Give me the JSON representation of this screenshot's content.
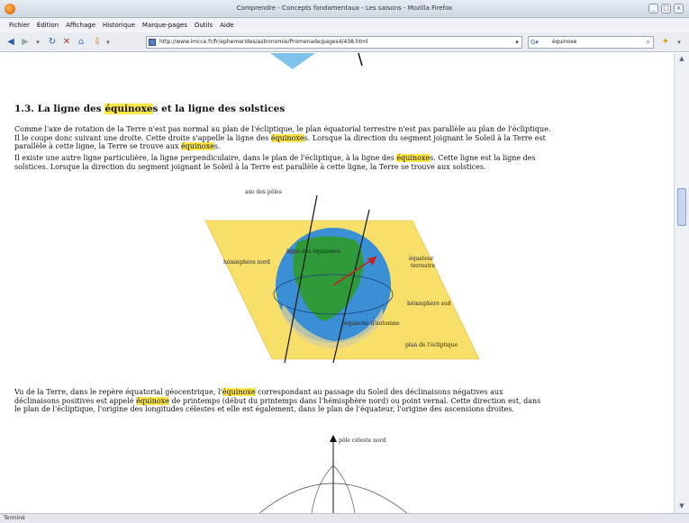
{
  "window": {
    "title": "Comprendre - Concepts fondamentaux - Les saisons - Mozilla Firefox",
    "buttons": [
      "_",
      "□",
      "×"
    ]
  },
  "menu": [
    "Fichier",
    "Édition",
    "Affichage",
    "Historique",
    "Marque-pages",
    "Outils",
    "Aide"
  ],
  "nav": {
    "url": "http://www.imcce.fr/fr/ephemerides/astronomie/Promenade/pages4/438.html",
    "search_value": "équinoxe",
    "search_engine": "G▾"
  },
  "content": {
    "heading_pre": "1.3. La ligne des ",
    "heading_hl": "équinoxe",
    "heading_post": "s et la ligne des solstices",
    "p1": {
      "a": "Comme l'axe de rotation de la Terre n'est pas normal au plan de l'écliptique, le plan équatorial terrestre n'est pas parallèle au plan de l'écliptique.",
      "b": "Il le coupe donc suivant une droite. Cette droite s'appelle la ligne des ",
      "b_hl": "équinoxe",
      "c": "s. Lorsque la direction du segment joignant le Soleil à la Terre est",
      "d": "parallèle à cette ligne, la Terre se trouve aux ",
      "d_hl": "équinoxe",
      "e": "s."
    },
    "p2": {
      "a": "Il existe une autre ligne particulière, la ligne perpendiculaire, dans le plan de l'écliptique, à la ligne des ",
      "a_hl": "équinoxe",
      "b": "s. Cette ligne est la ligne des",
      "c": "solstices. Lorsque la direction du segment joignant le Soleil à la Terre est parallèle à cette ligne, la Terre se trouve aux solstices."
    },
    "fig1_labels": {
      "axe": "axe des pôles",
      "hemi_nord": "hémisphère nord",
      "ligne": "ligne des équinoxes",
      "equateur_a": "équateur",
      "equateur_b": "terrestre",
      "hemi_sud": "hémisphère sud",
      "equinoxe": "équinoxe d'automne",
      "plan": "plan de l'écliptique"
    },
    "p3": {
      "a": "Vu de la Terre, dans le repère équatorial géocentrique, l'",
      "a_hl": "équinoxe",
      "b": " correspondant au passage du Soleil des déclinaisons négatives aux",
      "c": "déclinaisons positives est appelé ",
      "c_hl": "équinoxe",
      "d": " de printemps (début du printemps dans l'hémisphère nord) ou point vernal. Cette direction est, dans",
      "e": "le plan de l'écliptique, l'origine des longitudes célestes et elle est également, dans le plan de l'équateur, l'origine des ascensions droites."
    },
    "fig2_label": "pôle céleste nord"
  },
  "status": "Terminé",
  "colors": {
    "highlight": "#ffe74a",
    "plane": "#f7df6a",
    "ocean": "#3b8fd4",
    "land": "#2e9a3a"
  }
}
